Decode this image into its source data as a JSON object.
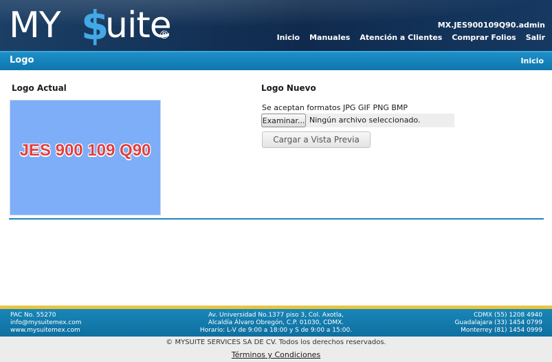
{
  "header": {
    "logo": {
      "my": "MY",
      "dollar": "$",
      "uite": "uite",
      "reg": "®"
    },
    "user": "MX.JES900109Q90.admin",
    "nav": [
      "Inicio",
      "Manuales",
      "Atención a Clientes",
      "Comprar Folios",
      "Salir"
    ],
    "colors": {
      "header_bg": "#0f2a4d",
      "brand_accent": "#43a8e6"
    }
  },
  "title_bar": {
    "title": "Logo",
    "home_link": "Inicio",
    "color": "#1384bd"
  },
  "logo_actual": {
    "label": "Logo Actual",
    "image_text": "JES 900 109 Q90",
    "image_bg": "#7eaef7"
  },
  "logo_nuevo": {
    "label": "Logo Nuevo",
    "formats_note": "Se aceptan formatos JPG GIF PNG BMP",
    "browse_button": "Examinar...",
    "file_status": "Ningún archivo seleccionado.",
    "preview_button": "Cargar a Vista Previa"
  },
  "footer": {
    "left": [
      "PAC No. 55270",
      "info@mysuitemex.com",
      "www.mysuitemex.com"
    ],
    "center": [
      "Av. Universidad No.1377 piso 3, Col. Axotla,",
      "Alcaldía Álvaro Obregón, C.P. 01030, CDMX.",
      "Horario: L-V de 9:00 a 18:00 y S de 9:00 a 15:00."
    ],
    "right": [
      "CDMX (55) 1208 4940",
      "Guadalajara (33) 1454 0799",
      "Monterrey (81) 1454 0999"
    ],
    "accent_color": "#e8c440"
  },
  "copyright": {
    "text": "© MYSUITE SERVICES SA DE CV. Todos los derechos reservados.",
    "terms": "Términos y Condiciones"
  }
}
